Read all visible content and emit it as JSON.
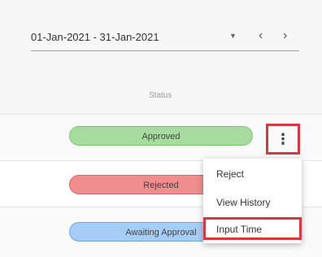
{
  "header": {
    "date_range": "01-Jan-2021 - 31-Jan-2021",
    "caret_icon": "▼",
    "prev_icon": "‹",
    "next_icon": "›"
  },
  "table": {
    "status_header": "Status",
    "rows": [
      {
        "status": "Approved"
      },
      {
        "status": "Rejected"
      },
      {
        "status": "Awaiting Approval"
      }
    ]
  },
  "row_actions": {
    "kebab_icon": "⋮"
  },
  "context_menu": {
    "items": [
      {
        "label": "Reject"
      },
      {
        "label": "View History"
      },
      {
        "label": "Input Time"
      }
    ]
  },
  "colors": {
    "approved": "#a7dc9f",
    "rejected": "#f08c8c",
    "awaiting": "#a6cdf6",
    "highlight": "#d8373b"
  }
}
